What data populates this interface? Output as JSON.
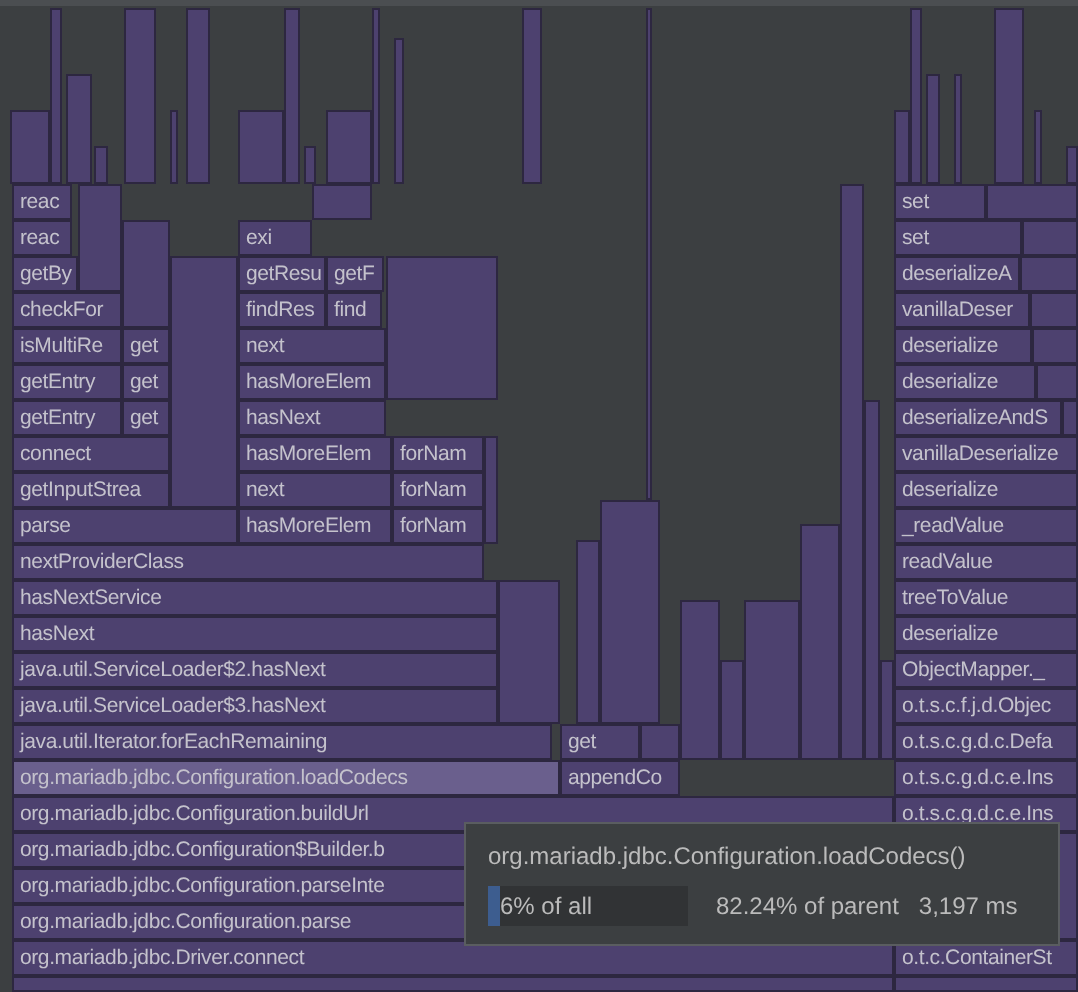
{
  "flame_graph": {
    "rows": [
      {
        "frames": [
          {
            "label": "reac",
            "selected": false
          },
          {
            "label": "set",
            "selected": false
          }
        ]
      },
      {
        "frames": [
          {
            "label": "reac",
            "selected": false
          },
          {
            "label": "exi",
            "selected": false
          },
          {
            "label": "set",
            "selected": false
          }
        ]
      },
      {
        "frames": [
          {
            "label": "getBy",
            "selected": false
          },
          {
            "label": "getResu",
            "selected": false
          },
          {
            "label": "getF",
            "selected": false
          },
          {
            "label": "deserializeA",
            "selected": false
          }
        ]
      },
      {
        "frames": [
          {
            "label": "checkFor",
            "selected": false
          },
          {
            "label": "findRes",
            "selected": false
          },
          {
            "label": "find",
            "selected": false
          },
          {
            "label": "vanillaDeser",
            "selected": false
          }
        ]
      },
      {
        "frames": [
          {
            "label": "isMultiRe",
            "selected": false
          },
          {
            "label": "get",
            "selected": false
          },
          {
            "label": "next",
            "selected": false
          },
          {
            "label": "deserialize",
            "selected": false
          }
        ]
      },
      {
        "frames": [
          {
            "label": "getEntry",
            "selected": false
          },
          {
            "label": "get",
            "selected": false
          },
          {
            "label": "hasMoreElem",
            "selected": false
          },
          {
            "label": "deserialize",
            "selected": false
          }
        ]
      },
      {
        "frames": [
          {
            "label": "getEntry",
            "selected": false
          },
          {
            "label": "get",
            "selected": false
          },
          {
            "label": "hasNext",
            "selected": false
          },
          {
            "label": "deserializeAndS",
            "selected": false
          }
        ]
      },
      {
        "frames": [
          {
            "label": "connect",
            "selected": false
          },
          {
            "label": "hasMoreElem",
            "selected": false
          },
          {
            "label": "forNam",
            "selected": false
          },
          {
            "label": "vanillaDeserialize",
            "selected": false
          }
        ]
      },
      {
        "frames": [
          {
            "label": "getInputStrea",
            "selected": false
          },
          {
            "label": "next",
            "selected": false
          },
          {
            "label": "forNam",
            "selected": false
          },
          {
            "label": "deserialize",
            "selected": false
          }
        ]
      },
      {
        "frames": [
          {
            "label": "parse",
            "selected": false
          },
          {
            "label": "hasMoreElem",
            "selected": false
          },
          {
            "label": "forNam",
            "selected": false
          },
          {
            "label": "_readValue",
            "selected": false
          }
        ]
      },
      {
        "frames": [
          {
            "label": "nextProviderClass",
            "selected": false
          },
          {
            "label": "readValue",
            "selected": false
          }
        ]
      },
      {
        "frames": [
          {
            "label": "hasNextService",
            "selected": false
          },
          {
            "label": "treeToValue",
            "selected": false
          }
        ]
      },
      {
        "frames": [
          {
            "label": "hasNext",
            "selected": false
          },
          {
            "label": "deserialize",
            "selected": false
          }
        ]
      },
      {
        "frames": [
          {
            "label": "java.util.ServiceLoader$2.hasNext",
            "selected": false
          },
          {
            "label": "ObjectMapper._",
            "selected": false
          }
        ]
      },
      {
        "frames": [
          {
            "label": "java.util.ServiceLoader$3.hasNext",
            "selected": false
          },
          {
            "label": "o.t.s.c.f.j.d.Objec",
            "selected": false
          }
        ]
      },
      {
        "frames": [
          {
            "label": "java.util.Iterator.forEachRemaining",
            "selected": false
          },
          {
            "label": "get",
            "selected": false
          },
          {
            "label": "o.t.s.c.g.d.c.Defa",
            "selected": false
          }
        ]
      },
      {
        "frames": [
          {
            "label": "org.mariadb.jdbc.Configuration.loadCodecs",
            "selected": true
          },
          {
            "label": "appendCo",
            "selected": false
          },
          {
            "label": "o.t.s.c.g.d.c.e.Ins",
            "selected": false
          }
        ]
      },
      {
        "frames": [
          {
            "label": "org.mariadb.jdbc.Configuration.buildUrl",
            "selected": false
          },
          {
            "label": "o.t.s.c.g.d.c.e.Ins",
            "selected": false
          }
        ]
      },
      {
        "frames": [
          {
            "label": "org.mariadb.jdbc.Configuration$Builder.b",
            "selected": false
          }
        ]
      },
      {
        "frames": [
          {
            "label": "org.mariadb.jdbc.Configuration.parseInte",
            "selected": false
          }
        ]
      },
      {
        "frames": [
          {
            "label": "org.mariadb.jdbc.Configuration.parse",
            "selected": false
          }
        ]
      },
      {
        "frames": [
          {
            "label": "org.mariadb.jdbc.Driver.connect",
            "selected": false
          },
          {
            "label": "o.t.c.ContainerSt",
            "selected": false
          }
        ]
      }
    ]
  },
  "tooltip": {
    "title": "org.mariadb.jdbc.Configuration.loadCodecs()",
    "share_of_all": "6% of all",
    "level": 0.06,
    "share_of_parent": "82.24% of parent",
    "time": "3,197 ms"
  }
}
